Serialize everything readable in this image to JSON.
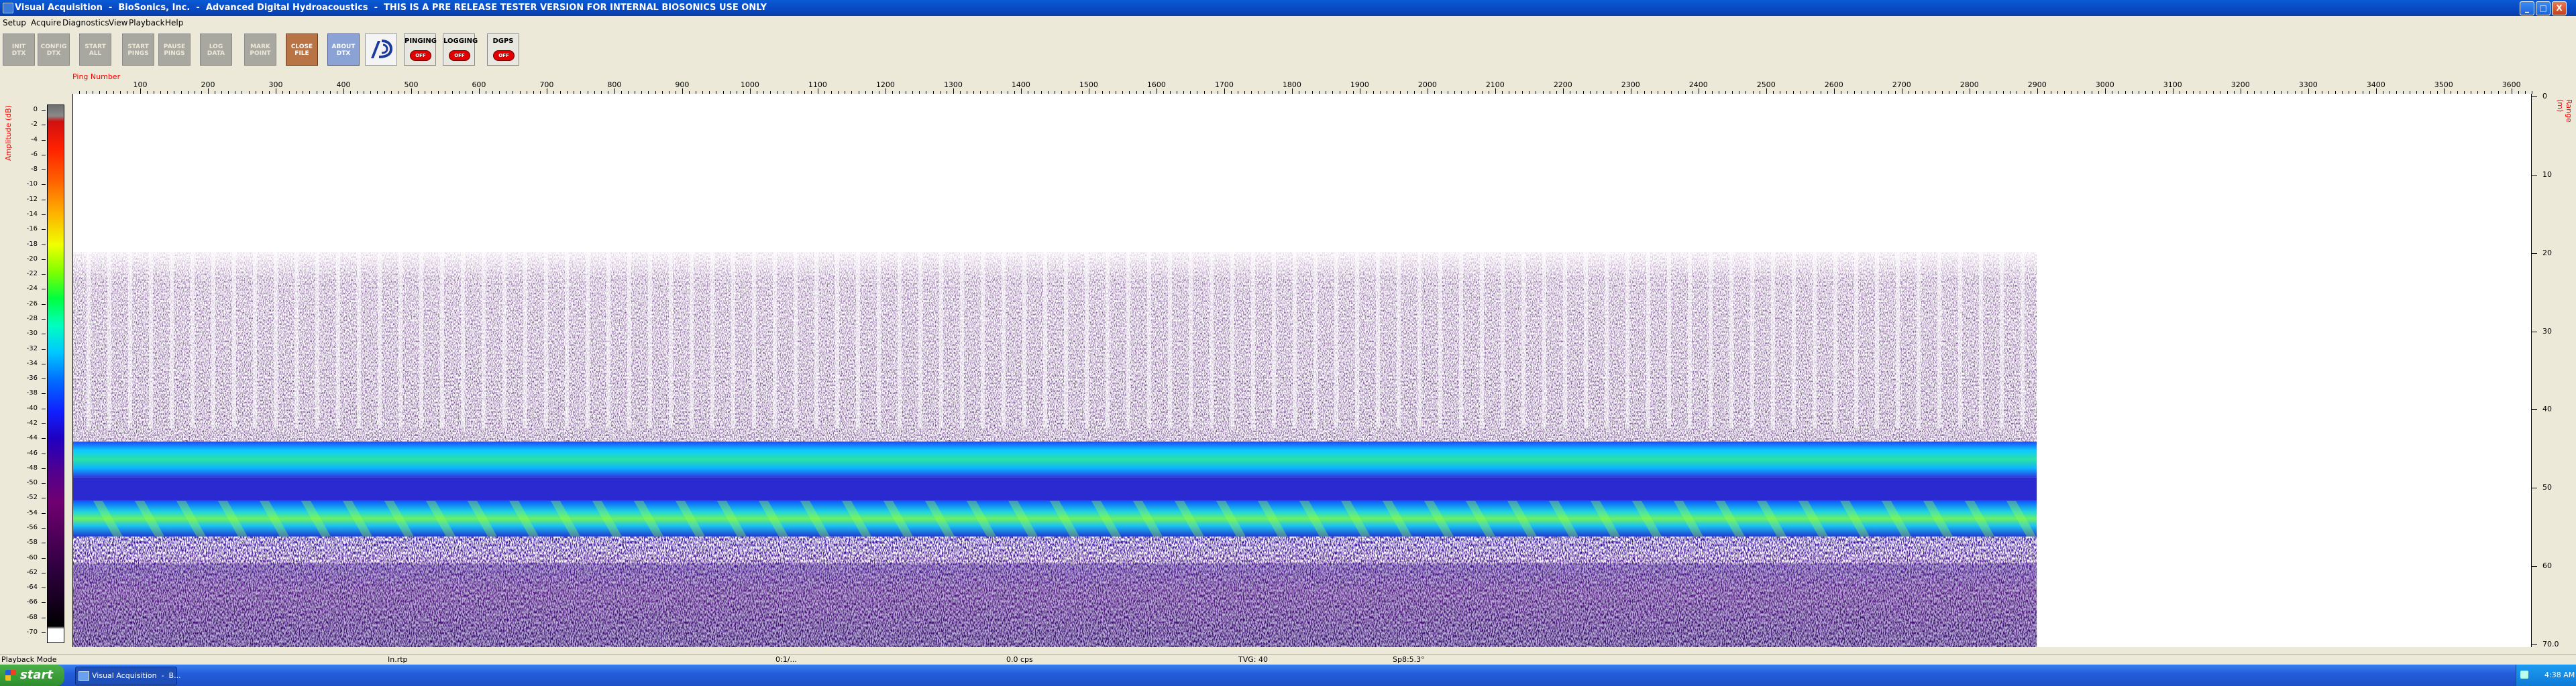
{
  "window": {
    "title": "Visual Acquisition  -  BioSonics, Inc.  -  Advanced Digital Hydroacoustics  -  THIS IS A PRE RELEASE TESTER VERSION FOR INTERNAL BIOSONICS USE ONLY",
    "min_label": "_",
    "max_label": "□",
    "close_label": "X"
  },
  "menu": [
    "Setup",
    "Acquire",
    "Diagnostics",
    "View",
    "Playback",
    "Help"
  ],
  "toolbar": {
    "buttons": [
      "INIT\nDTX",
      "CONFIG\nDTX",
      "START\nALL",
      "START\nPINGS",
      "PAUSE\nPINGS",
      "LOG\nDATA",
      "MARK\nPOINT",
      "CLOSE\nFILE",
      "ABOUT\nDTX"
    ],
    "status_panels": [
      {
        "label": "PINGING",
        "value": "OFF"
      },
      {
        "label": "LOGGING",
        "value": "OFF"
      },
      {
        "label": "DGPS",
        "value": "OFF"
      }
    ],
    "accent_close": "#b87444",
    "accent_about": "#8aa2d4",
    "status_off_color": "#e00000"
  },
  "plot": {
    "x_title": "Ping Number",
    "y_left_title": "Amplitude (dB)",
    "y_right_title": "Range (m)",
    "x_ticks": [
      "100",
      "200",
      "300",
      "400",
      "500",
      "600",
      "700",
      "800",
      "900",
      "1000",
      "1100",
      "1200",
      "1300",
      "1400",
      "1500",
      "1600",
      "1700",
      "1800",
      "1900",
      "2000",
      "2100",
      "2200",
      "2300",
      "2400",
      "2500",
      "2600",
      "2700",
      "2800",
      "2900",
      "3000",
      "3100",
      "3200",
      "3300",
      "3400",
      "3500",
      "3600"
    ],
    "range_ticks": [
      "0",
      "10",
      "20",
      "30",
      "40",
      "50",
      "60",
      "70.0"
    ],
    "amp_ticks": [
      "0",
      "-2",
      "-4",
      "-6",
      "-8",
      "-10",
      "-12",
      "-14",
      "-16",
      "-18",
      "-20",
      "-22",
      "-24",
      "-26",
      "-28",
      "-30",
      "-32",
      "-34",
      "-36",
      "-38",
      "-40",
      "-42",
      "-44",
      "-46",
      "-48",
      "-50",
      "-52",
      "-54",
      "-56",
      "-58",
      "-60",
      "-62",
      "-64",
      "-66",
      "-68",
      "-70"
    ],
    "data_last_ping": 2900,
    "x_max": 3630,
    "range_max_m": 70,
    "layers": {
      "surface_noise_top_m": 20,
      "band1_m": [
        44,
        48.5
      ],
      "band2_m": [
        51.5,
        56
      ],
      "bottom_m": 70
    }
  },
  "statusbar": [
    "Playback Mode",
    "In.rtp",
    "0:1/...",
    "0.0 cps",
    "TVG: 40",
    "Sp8:5.3°"
  ],
  "taskbar": {
    "start_label": "start",
    "item_label": "Visual Acquisition  -  B...",
    "clock": "4:38 AM"
  }
}
